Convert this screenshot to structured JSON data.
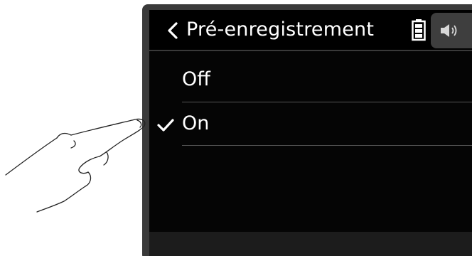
{
  "header": {
    "title": "Pré-enregistrement"
  },
  "icons": {
    "back": "chevron-left-icon",
    "battery": "battery-icon",
    "speaker": "speaker-icon",
    "check": "checkmark-icon",
    "hand": "pointing-hand-illustration"
  },
  "menu": {
    "items": [
      {
        "label": "Off",
        "selected": false
      },
      {
        "label": "On",
        "selected": true
      }
    ]
  },
  "colors": {
    "screen_background": "#050505",
    "text": "#ffffff",
    "divider": "#555555",
    "speaker_button": "#3e3e3e",
    "bezel": "#3a3a3a"
  }
}
